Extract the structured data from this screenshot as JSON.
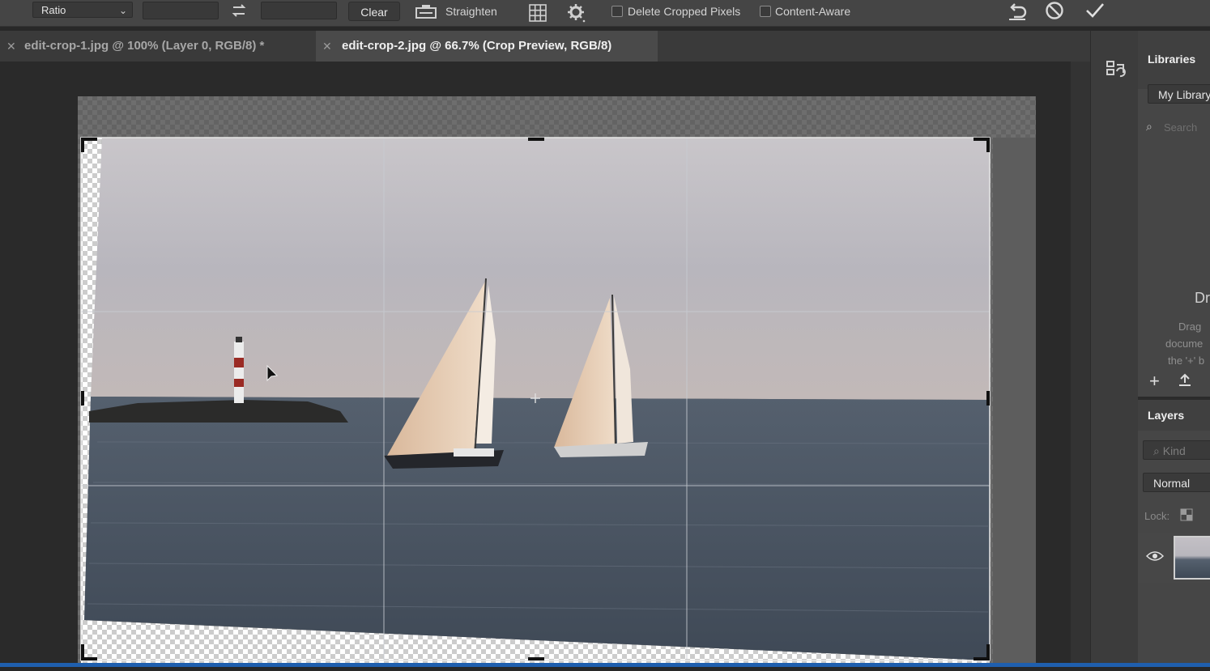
{
  "options_bar": {
    "ratio_label": "Ratio",
    "clear_label": "Clear",
    "straighten_label": "Straighten",
    "delete_cropped_label": "Delete Cropped Pixels",
    "content_aware_label": "Content-Aware",
    "icons": [
      "swap-icon",
      "level-icon",
      "overlay-grid-icon",
      "gear-icon",
      "reset-icon",
      "cancel-icon",
      "commit-check-icon"
    ]
  },
  "tabs": [
    {
      "label": "edit-crop-1.jpg @ 100% (Layer 0, RGB/8) *"
    },
    {
      "label": "edit-crop-2.jpg @ 66.7% (Crop Preview, RGB/8)"
    }
  ],
  "libraries_panel": {
    "title": "Libraries",
    "library_select": "My Library",
    "search_placeholder": "Search",
    "drag_heading": "Dr",
    "drag_text_1": "Drag",
    "drag_text_2": "docume",
    "drag_text_3": "the '+' b"
  },
  "layers_panel": {
    "title": "Layers",
    "kind_placeholder": "Kind",
    "blend_mode": "Normal",
    "lock_label": "Lock:"
  },
  "colors": {
    "accent_blue": "#1f5fae",
    "panel_bg": "#464646",
    "app_bg": "#282828"
  }
}
